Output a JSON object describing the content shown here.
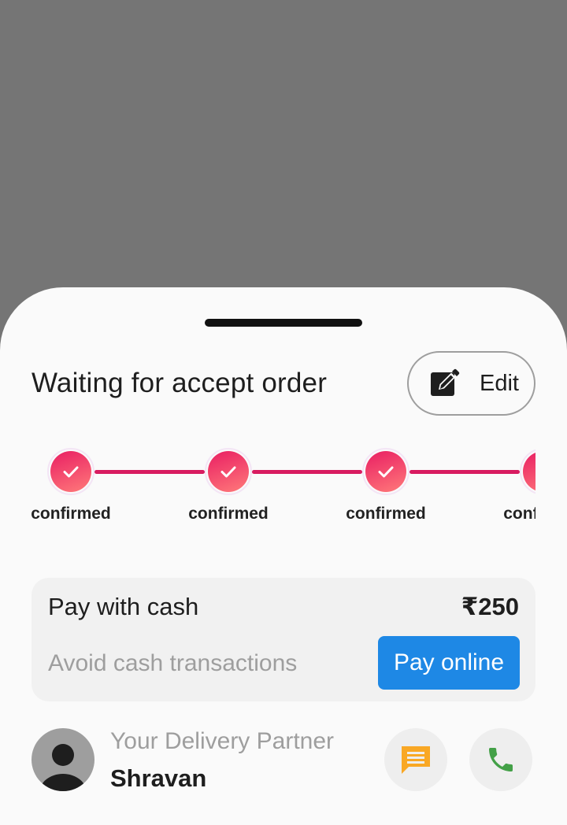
{
  "order": {
    "status_title": "Waiting for accept order",
    "edit_label": "Edit"
  },
  "steps": [
    {
      "label": "confirmed",
      "done": true
    },
    {
      "label": "confirmed",
      "done": true
    },
    {
      "label": "confirmed",
      "done": true
    },
    {
      "label": "confirmed",
      "done": true
    }
  ],
  "payment": {
    "title": "Pay with cash",
    "amount": "₹250",
    "subtitle": "Avoid cash transactions",
    "pay_online_label": "Pay online"
  },
  "partner": {
    "label": "Your Delivery Partner",
    "name": "Shravan"
  },
  "colors": {
    "accent": "#d81b60",
    "pay_button": "#1e88e5",
    "chat_icon": "#f9a825",
    "call_icon": "#43a047"
  },
  "icons": {
    "edit": "edit-icon",
    "check": "check-icon",
    "chat": "chat-icon",
    "phone": "phone-icon",
    "avatar": "person-icon"
  }
}
